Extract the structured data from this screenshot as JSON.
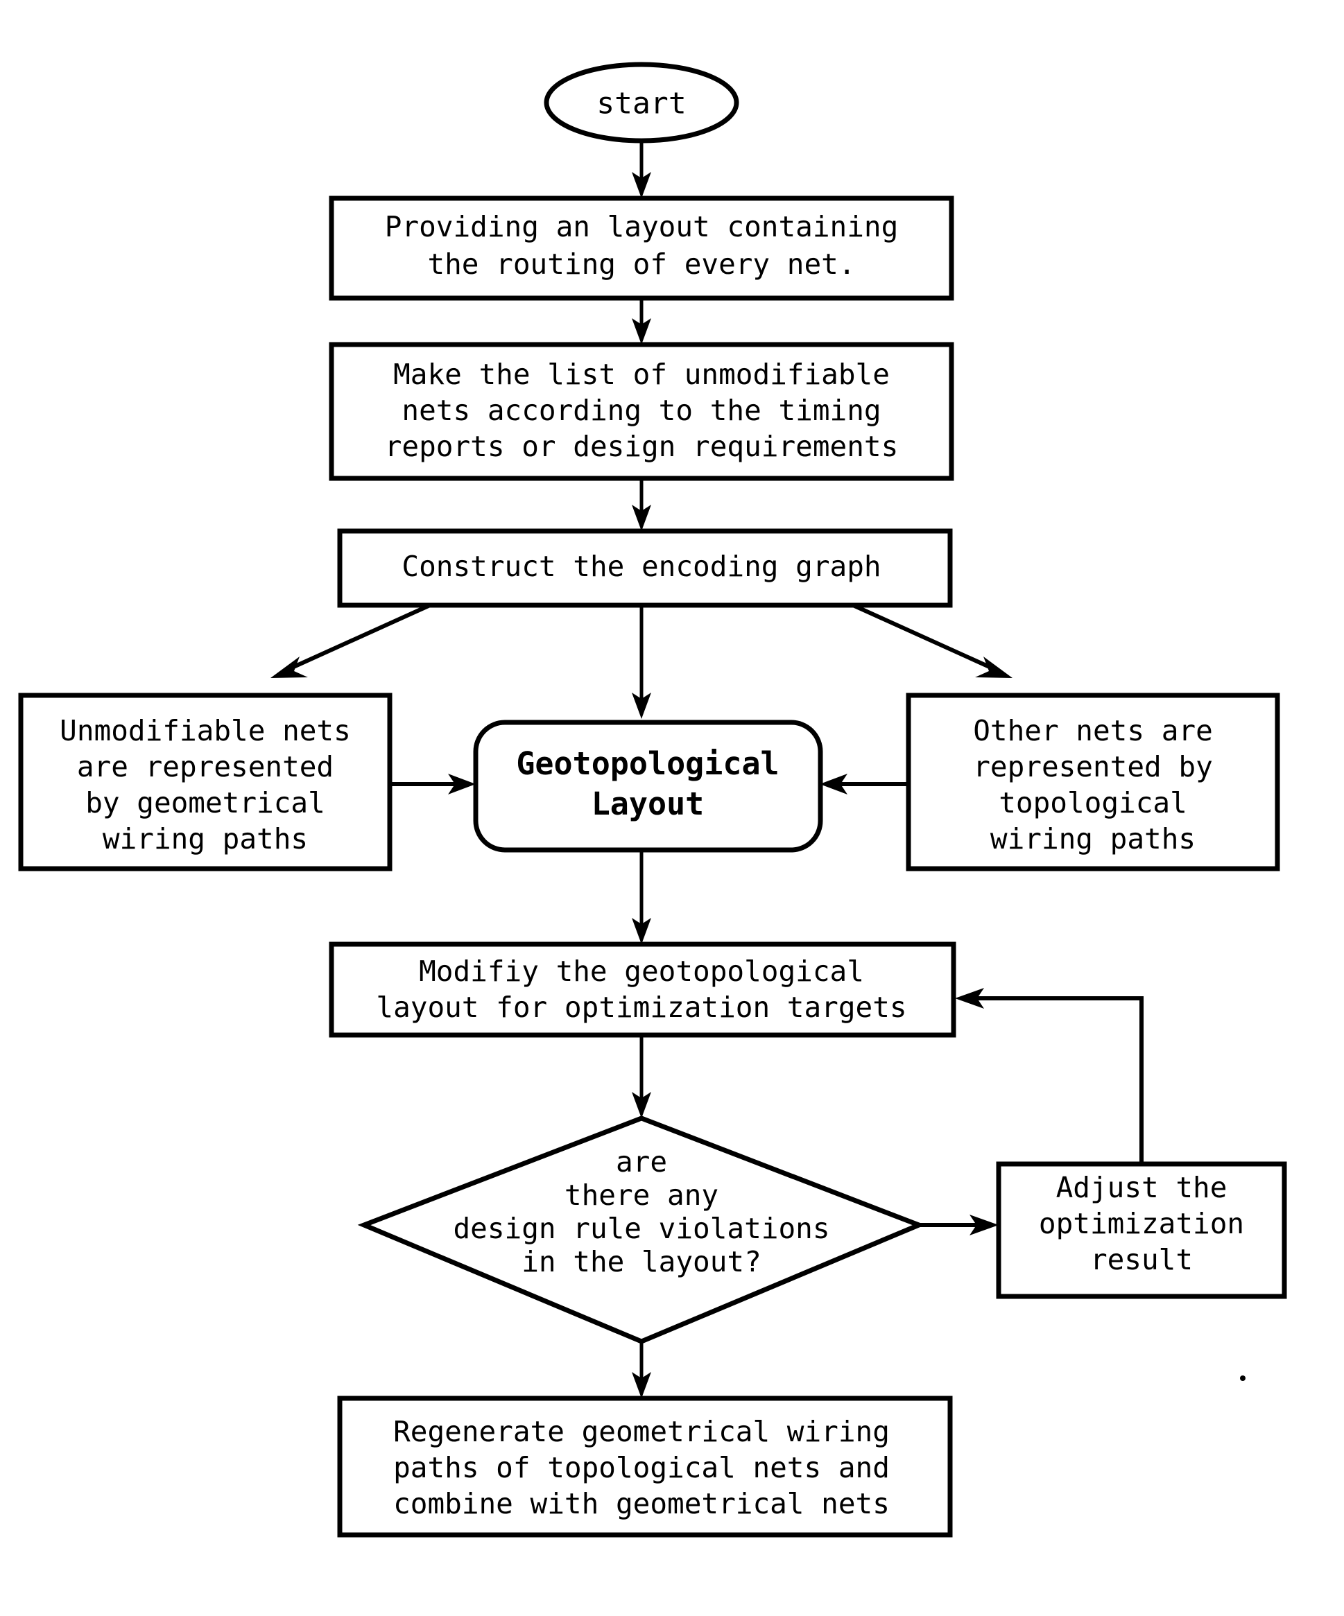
{
  "diagram": {
    "title": "Geotopological layout optimization flowchart",
    "colors": {
      "stroke": "#000000",
      "fill": "#ffffff",
      "text": "#000000"
    },
    "nodes": {
      "start": {
        "shape": "ellipse",
        "lines": [
          "start"
        ]
      },
      "providing_layout": {
        "shape": "process",
        "lines": [
          "Providing an layout containing",
          "the routing of every net."
        ]
      },
      "make_list": {
        "shape": "process",
        "lines": [
          "Make the list of unmodifiable",
          "nets according to the timing",
          "reports or design requirements"
        ]
      },
      "construct_graph": {
        "shape": "process",
        "lines": [
          "Construct the encoding graph"
        ]
      },
      "unmodifiable_nets": {
        "shape": "process",
        "lines": [
          "Unmodifiable nets",
          "are represented",
          "by geometrical",
          "wiring paths"
        ]
      },
      "geotopological_layout": {
        "shape": "rounded-process",
        "lines": [
          "Geotopological",
          "Layout"
        ]
      },
      "other_nets": {
        "shape": "process",
        "lines": [
          "Other nets are",
          "represented by",
          "topological",
          "wiring paths"
        ]
      },
      "modify_layout": {
        "shape": "process",
        "lines": [
          "Modifiy the geotopological",
          "layout for optimization targets"
        ]
      },
      "decision_drv": {
        "shape": "decision",
        "lines": [
          "are",
          "there any",
          "design rule violations",
          "in the layout?"
        ]
      },
      "adjust_result": {
        "shape": "process",
        "lines": [
          "Adjust the",
          "optimization",
          "result"
        ]
      },
      "regenerate": {
        "shape": "process",
        "lines": [
          "Regenerate geometrical wiring",
          "paths of topological nets and",
          "combine with geometrical nets"
        ]
      }
    },
    "edges": [
      {
        "id": "start-to-providing",
        "from": "start",
        "to": "providing_layout",
        "label": ""
      },
      {
        "id": "providing-to-makelist",
        "from": "providing_layout",
        "to": "make_list",
        "label": ""
      },
      {
        "id": "makelist-to-construct",
        "from": "make_list",
        "to": "construct_graph",
        "label": ""
      },
      {
        "id": "construct-to-unmodifiable",
        "from": "construct_graph",
        "to": "unmodifiable_nets",
        "label": ""
      },
      {
        "id": "construct-to-geotopological",
        "from": "construct_graph",
        "to": "geotopological_layout",
        "label": ""
      },
      {
        "id": "construct-to-other",
        "from": "construct_graph",
        "to": "other_nets",
        "label": ""
      },
      {
        "id": "unmodifiable-to-geotopological",
        "from": "unmodifiable_nets",
        "to": "geotopological_layout",
        "label": ""
      },
      {
        "id": "other-to-geotopological",
        "from": "other_nets",
        "to": "geotopological_layout",
        "label": ""
      },
      {
        "id": "geotopological-to-modify",
        "from": "geotopological_layout",
        "to": "modify_layout",
        "label": ""
      },
      {
        "id": "modify-to-decision",
        "from": "modify_layout",
        "to": "decision_drv",
        "label": ""
      },
      {
        "id": "decision-to-adjust",
        "from": "decision_drv",
        "to": "adjust_result",
        "label": ""
      },
      {
        "id": "adjust-to-modify",
        "from": "adjust_result",
        "to": "modify_layout",
        "label": ""
      },
      {
        "id": "decision-to-regenerate",
        "from": "decision_drv",
        "to": "regenerate",
        "label": ""
      }
    ]
  }
}
